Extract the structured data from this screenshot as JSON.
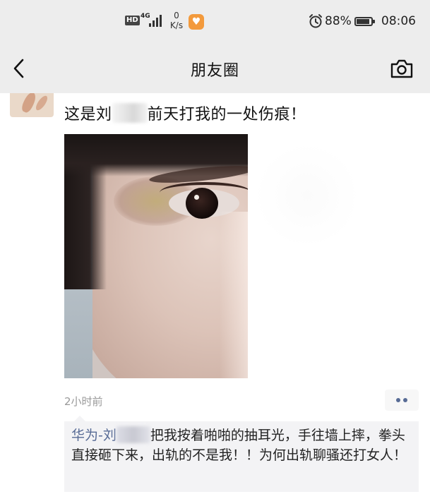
{
  "status_bar": {
    "hd": "HD",
    "network": "4G",
    "speed_value": "0",
    "speed_unit": "K/s",
    "battery_percent": "88%",
    "battery_level": 0.88,
    "time": "08:06",
    "icons": [
      "hd-icon",
      "signal-icon",
      "app-notification-icon",
      "alarm-icon",
      "battery-icon"
    ]
  },
  "nav": {
    "title": "朋友圈",
    "back_icon": "chevron-left-icon",
    "camera_icon": "camera-icon"
  },
  "post": {
    "text_before": "这是刘",
    "text_after": "前天打我的一处伤痕！",
    "time_ago": "2小时前",
    "more_icon": "more-dots-icon"
  },
  "comment": {
    "author": "华为-刘",
    "text": "把我按着啪啪的抽耳光，手往墙上摔，拳头直接砸下来，出轨的不是我！！为何出轨聊骚还打女人！"
  },
  "colors": {
    "link_blue": "#576b95",
    "background": "#ededed",
    "card": "#ffffff"
  }
}
